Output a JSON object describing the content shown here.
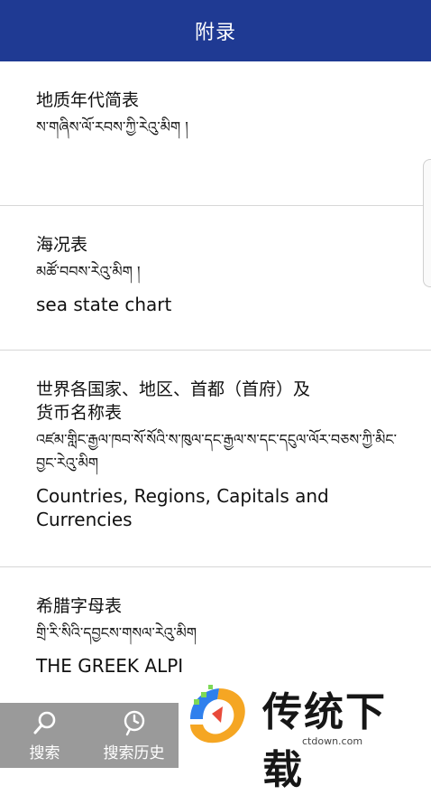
{
  "header": {
    "title": "附录"
  },
  "entries": [
    {
      "cn": "地质年代简表",
      "tib": "ས་གཞིས་ལོ་རབས་ཀྱི་རེའུ་མིག །",
      "en": ""
    },
    {
      "cn": "海况表",
      "tib": "མཚོ་བབས་རེའུ་མིག །",
      "en": "sea state chart"
    },
    {
      "cn": "世界各国家、地区、首都（首府）及货币名称表",
      "tib": "འཛམ་གླིང་རྒྱལ་ཁབ་སོ་སོའི་ས་ཁུལ་དང་རྒྱལ་ས་དང་དངུལ་ལོར་བཅས་ཀྱི་མིང་བྱང་རེའུ་མིག",
      "en": "Countries, Regions, Capitals and Currencies"
    },
    {
      "cn": "希腊字母表",
      "tib": "གྲི་རི་སིའི་དབྱངས་གསལ་རེའུ་མིག",
      "en": "THE GREEK ALPI"
    }
  ],
  "bottom_nav": {
    "search_label": "搜索",
    "history_label": "搜索历史",
    "search_icon": "search-icon",
    "history_icon": "history-icon"
  },
  "watermark": {
    "brand": "传统下载",
    "domain": "ctdown.com"
  },
  "colors": {
    "header_bg": "#1f3a93",
    "bottom_bar_bg": "#9a9a9a",
    "divider": "#d7d7d7"
  }
}
